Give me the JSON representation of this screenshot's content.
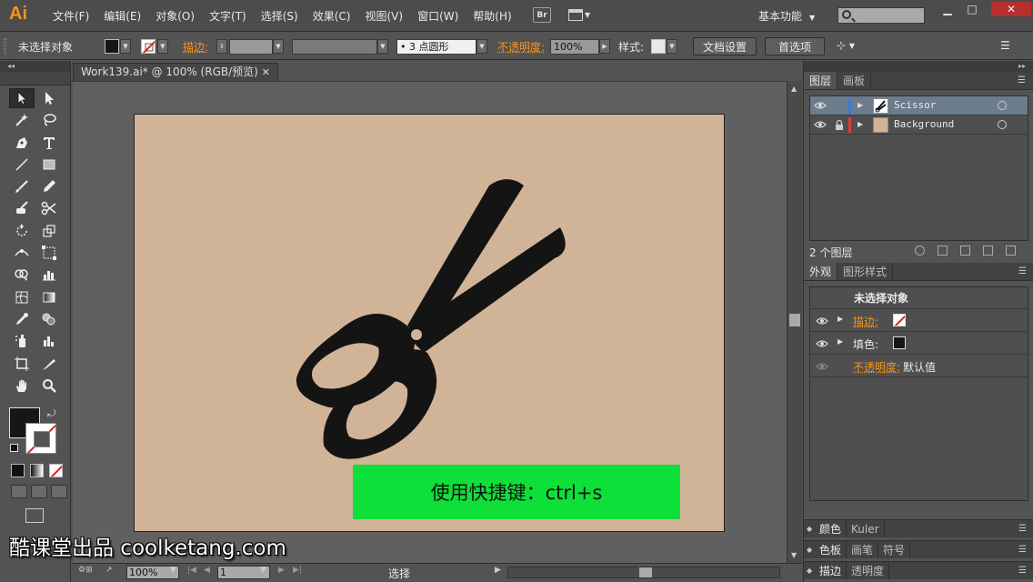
{
  "app": {
    "logo": "Ai",
    "bridge_label": "Br",
    "workspace": "基本功能"
  },
  "menu": [
    "文件(F)",
    "编辑(E)",
    "对象(O)",
    "文字(T)",
    "选择(S)",
    "效果(C)",
    "视图(V)",
    "窗口(W)",
    "帮助(H)"
  ],
  "window_controls": {
    "minimize": "▁",
    "maximize": "□",
    "close": "✕"
  },
  "control_bar": {
    "selection_status": "未选择对象",
    "stroke_label": "描边",
    "brush_label": "3 点圆形",
    "opacity_label": "不透明度",
    "opacity_value": "100%",
    "style_label": "样式",
    "doc_setup_button": "文档设置",
    "preferences_button": "首选项"
  },
  "document": {
    "tab_title": "Work139.ai* @ 100% (RGB/预览)"
  },
  "banner": {
    "text": "使用快捷键：ctrl+s"
  },
  "status_bar": {
    "zoom": "100%",
    "page": "1",
    "current_tool": "选择"
  },
  "layers_panel": {
    "tabs": [
      "图层",
      "画板"
    ],
    "layers": [
      {
        "name": "Scissor",
        "color": "#3a7bd5",
        "selected": true,
        "locked": false
      },
      {
        "name": "Background",
        "color": "#e03a3a",
        "selected": false,
        "locked": true
      }
    ],
    "count_label": "2 个图层"
  },
  "appearance_panel": {
    "tabs": [
      "外观",
      "图形样式"
    ],
    "title": "未选择对象",
    "stroke_label": "描边",
    "fill_label": "填色",
    "opacity_label": "不透明度",
    "opacity_value": "默认值",
    "fx_label": "fx"
  },
  "collapsed_panels": [
    {
      "tabs": [
        "颜色",
        "Kuler"
      ]
    },
    {
      "tabs": [
        "色板",
        "画笔",
        "符号"
      ]
    },
    {
      "tabs": [
        "描边",
        "透明度"
      ]
    }
  ],
  "colors": {
    "accent": "#f7941d",
    "artboard": "#d1b498",
    "scissor": "#141414",
    "banner": "#0edf39",
    "selected_layer": "#6b7c8c"
  },
  "watermark": {
    "text": "酷课堂出品 coolketang.com"
  }
}
